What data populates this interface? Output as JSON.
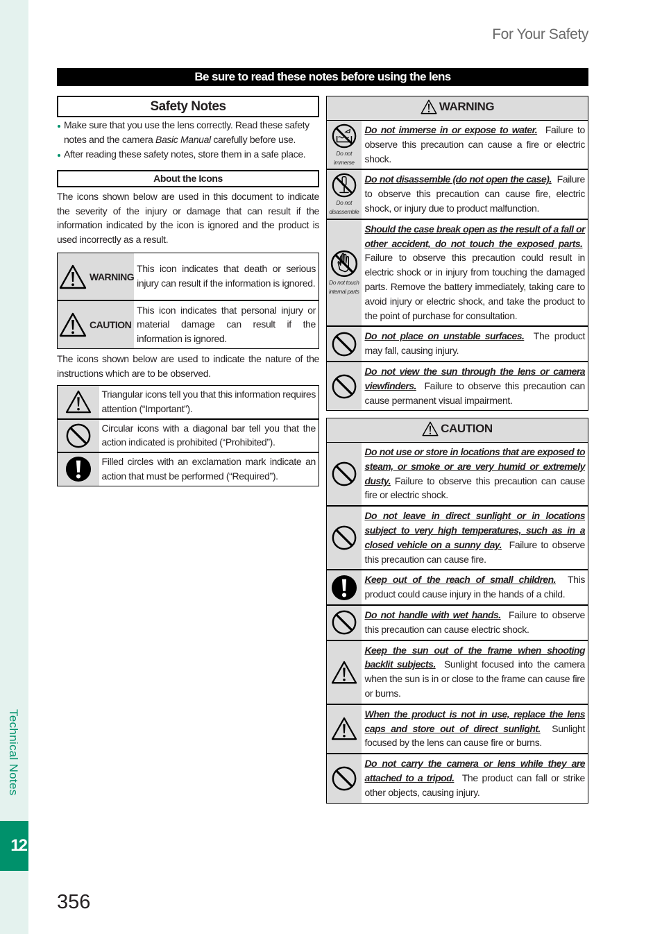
{
  "running_head": "For Your Safety",
  "page_number": "356",
  "side_tab": {
    "label": "Technical Notes",
    "chapter": "12"
  },
  "colors": {
    "accent": "#00916b",
    "accent_light": "#e4f2ee",
    "cell_gray": "#dcdcdc"
  },
  "banner": "Be sure to read these notes before using the lens",
  "left": {
    "safety_title": "Safety Notes",
    "bullets": [
      {
        "before": "Make sure that you use the lens correctly.  Read these safety notes and the camera ",
        "italic": "Basic Manual",
        "after": " carefully before use."
      },
      {
        "before": "After reading these safety notes, store them in a safe place.",
        "italic": "",
        "after": ""
      }
    ],
    "about_title": "About the Icons",
    "about_para": "The icons shown below are used in this document to indicate the severity of the injury or damage that can result if the information indicated by the icon is ignored and the product is used incorrectly as a result.",
    "severity": [
      {
        "icon": "warning-triangle-icon",
        "label": "WARNING",
        "text": "This icon indicates that death or serious injury can result if the information is ignored."
      },
      {
        "icon": "caution-triangle-icon",
        "label": "CAUTION",
        "text": "This icon indicates that personal injury or material damage can result if the information is ignored."
      }
    ],
    "nature_para": "The icons shown below are used to indicate the nature of the instructions which are to be observed.",
    "nature": [
      {
        "icon": "triangle-exclamation-icon",
        "text": "Triangular icons tell you that this information requires attention (“Important”)."
      },
      {
        "icon": "prohibited-icon",
        "text": "Circular icons with a diagonal bar tell you that the action indicated is prohibited (“Prohibited”)."
      },
      {
        "icon": "required-icon",
        "text": "Filled circles with an exclamation mark indicate an action that must be performed (“Required”)."
      }
    ]
  },
  "warning": {
    "title": "WARNING",
    "items": [
      {
        "icon": "do-not-immerse-icon",
        "caption": "Do not immerse",
        "lead": "Do not immerse in or expose to water.",
        "text": "Failure to observe this precaution can cause a fire or electric shock."
      },
      {
        "icon": "do-not-disassemble-icon",
        "caption": "Do not disassemble",
        "lead": "Do not disassemble (do not open the case).",
        "text": "Failure to observe this precaution can cause fire, electric shock, or injury due to product malfunction."
      },
      {
        "icon": "do-not-touch-icon",
        "caption": "Do not touch internal parts",
        "lead": "Should the case break open as the result of a fall or other accident, do not touch the exposed parts.",
        "text": "Failure to observe this precaution could result in electric shock or in injury from touching the damaged parts.  Remove the battery immediately, taking care to avoid injury or electric shock, and take the product to the point of purchase for consultation."
      },
      {
        "icon": "prohibited-icon",
        "caption": "",
        "lead": "Do not place on unstable surfaces.",
        "text": "The product may fall, causing injury."
      },
      {
        "icon": "prohibited-icon",
        "caption": "",
        "lead": "Do not view the sun through the lens or camera viewfinders.",
        "text": "Failure to observe this precaution can cause permanent visual impairment."
      }
    ]
  },
  "caution": {
    "title": "CAUTION",
    "items": [
      {
        "icon": "prohibited-icon",
        "lead": "Do not use or store in locations that are exposed to steam, or smoke or are very humid or extremely dusty.",
        "text": "Failure to observe this precaution can cause fire or electric shock."
      },
      {
        "icon": "prohibited-icon",
        "lead": "Do not leave in direct sunlight or in locations subject to very high temperatures, such as in a closed vehicle on a sunny day.",
        "text": "Failure to observe this precaution can cause fire."
      },
      {
        "icon": "required-icon",
        "lead": "Keep out of the reach of small children.",
        "text": "This product could cause injury in the hands of a child."
      },
      {
        "icon": "prohibited-icon",
        "lead": "Do not handle with wet hands.",
        "text": "Failure to observe this precaution can cause electric shock."
      },
      {
        "icon": "triangle-exclamation-icon",
        "lead": "Keep the sun out of the frame when shooting backlit subjects.",
        "text": "Sunlight focused into the camera when the sun is in or close to the frame can cause fire or burns."
      },
      {
        "icon": "triangle-exclamation-icon",
        "lead": "When the product is not in use, replace the lens caps and store out of direct sunlight.",
        "text": "Sunlight focused by the lens can cause fire or burns."
      },
      {
        "icon": "prohibited-icon",
        "lead": "Do not carry the camera or lens while they are attached to a tripod.",
        "text": "The product can fall or strike other objects, causing injury."
      }
    ]
  }
}
